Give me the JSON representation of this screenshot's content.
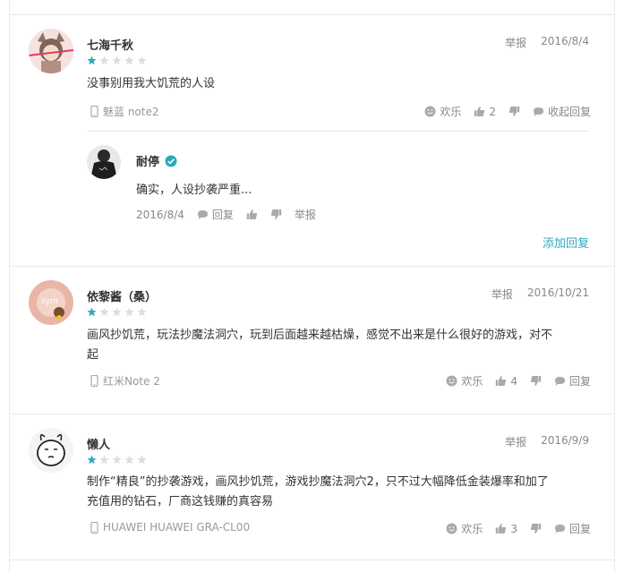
{
  "reviews": [
    {
      "user": "七海千秋",
      "report": "举报",
      "date": "2016/8/4",
      "rating": 1,
      "content": "没事别用我大饥荒的人设",
      "device": "魅蓝 note2",
      "fun_label": "欢乐",
      "likes": "2",
      "reply_label": "收起回复",
      "reply": {
        "user": "耐停",
        "text": "确实，人设抄袭严重...",
        "date": "2016/8/4",
        "reply_label": "回复",
        "report": "举报"
      },
      "add_reply": "添加回复"
    },
    {
      "user": "依黎酱（桑）",
      "report": "举报",
      "date": "2016/10/21",
      "rating": 1,
      "content_line1": "画风抄饥荒，玩法抄魔法洞穴，玩到后面越来越枯燥，感觉不出来是什么很好的游戏，对不",
      "content_line2": "起",
      "device": "红米Note 2",
      "fun_label": "欢乐",
      "likes": "4",
      "reply_label": "回复"
    },
    {
      "user": "懒人",
      "report": "举报",
      "date": "2016/9/9",
      "rating": 1,
      "content_line1": "制作“精良”的抄袭游戏，画风抄饥荒，游戏抄魔法洞穴2，只不过大幅降低金装爆率和加了",
      "content_line2": "充值用的钻石，厂商这钱赚的真容易",
      "device": "HUAWEI HUAWEI GRA-CL00",
      "fun_label": "欢乐",
      "likes": "3",
      "reply_label": "回复"
    }
  ],
  "colors": {
    "accent": "#2eaabe",
    "star_on": "#2eaabe",
    "star_off": "#dddddd",
    "verified": "#2eaabe"
  }
}
